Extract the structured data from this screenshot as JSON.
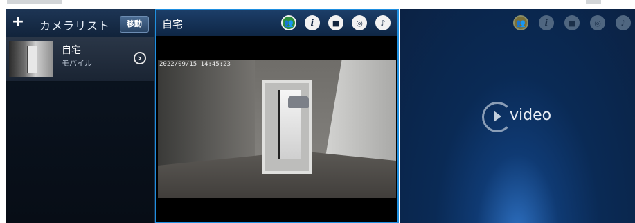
{
  "sidebar": {
    "add_icon": "plus-icon",
    "title": "カメラリスト",
    "move_label": "移動",
    "cameras": [
      {
        "name": "自宅",
        "type": "モバイル",
        "action_icon": "chevron-right-circle-icon"
      }
    ]
  },
  "main_view": {
    "title": "自宅",
    "timestamp": "2022/09/15 14:45:23",
    "toolbar_icons": [
      "people-icon",
      "info-icon",
      "record-icon",
      "snapshot-icon",
      "talk-icon"
    ]
  },
  "secondary_view": {
    "placeholder_text": "video",
    "toolbar_icons": [
      "people-icon",
      "info-icon",
      "record-icon",
      "snapshot-icon",
      "talk-icon"
    ]
  },
  "colors": {
    "accent_border": "#1f8fe0",
    "header_bg": "#1c3e68",
    "panel_bg": "#0a2a55"
  }
}
